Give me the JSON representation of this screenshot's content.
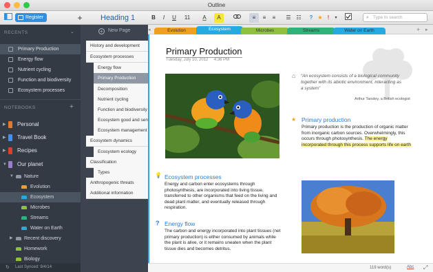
{
  "window": {
    "title": "Outline"
  },
  "toolbar": {
    "register_label": "Register",
    "add_label": "+",
    "heading_style": "Heading 1",
    "bold": "B",
    "italic": "I",
    "underline": "U",
    "font_size": "11",
    "search_placeholder": "Type to search"
  },
  "sidebar": {
    "recents_header": "RECENTS",
    "recents": [
      "Primary Production",
      "Energy flow",
      "Nutrient cycling",
      "Function and biodiversity",
      "Ecosystem processes"
    ],
    "notebooks_header": "NOTEBOOKS",
    "notebooks": [
      {
        "label": "Personal",
        "color": "#e07a2e"
      },
      {
        "label": "Travel Book",
        "color": "#4a8ee6"
      },
      {
        "label": "Recipes",
        "color": "#d9402f"
      },
      {
        "label": "Our planet",
        "color": "#9b7fc6"
      }
    ],
    "nature_label": "Nature",
    "sections": [
      {
        "label": "Evolution",
        "color": "#f0a020"
      },
      {
        "label": "Ecosystem",
        "color": "#27a9e1"
      },
      {
        "label": "Microbes",
        "color": "#8fc13e"
      },
      {
        "label": "Streams",
        "color": "#2fb37a"
      },
      {
        "label": "Water on Earth",
        "color": "#27a9e1"
      }
    ],
    "recent_discovery": "Recent discovery",
    "homework": "Homework",
    "biology": "Biology",
    "last_synced": "Last Synced: 9/4/14"
  },
  "pagelist": {
    "new_page": "New Page",
    "pages": [
      {
        "label": "History and development",
        "level": 0
      },
      {
        "label": "Ecosystem processes",
        "level": 0
      },
      {
        "label": "Energy flow",
        "level": 1
      },
      {
        "label": "Primary Production",
        "level": 1,
        "selected": true
      },
      {
        "label": "Decomposition",
        "level": 1
      },
      {
        "label": "Nutrient cycling",
        "level": 1
      },
      {
        "label": "Function and biodiversity",
        "level": 1
      },
      {
        "label": "Ecosystem good and services",
        "level": 1
      },
      {
        "label": "Ecosystem management",
        "level": 1
      },
      {
        "label": "Ecosystem dynamics",
        "level": 0
      },
      {
        "label": "Ecosystem ecology",
        "level": 1
      },
      {
        "label": "Classification",
        "level": 0
      },
      {
        "label": "Types",
        "level": 1
      },
      {
        "label": "Anthropogenic threats",
        "level": 0
      },
      {
        "label": "Additional information",
        "level": 0
      }
    ]
  },
  "tabs": [
    {
      "label": "Evolution",
      "color": "#f0a020"
    },
    {
      "label": "Ecosystem",
      "color": "#27a9e1"
    },
    {
      "label": "Microbes",
      "color": "#8fc13e"
    },
    {
      "label": "Streams",
      "color": "#2fb37a"
    },
    {
      "label": "Water on Earth",
      "color": "#27a9e1"
    }
  ],
  "note": {
    "title": "Primary Production",
    "date": "Tuesday, July 10, 2012",
    "time": "4:36 PM",
    "quote": "“An ecosystem consists of a biological community together with its abiotic environment, interacting as a system”",
    "quote_author": "Arthur Tansley, a British ecologist",
    "sec1_title": "Primary production",
    "sec1_text": "Primary production is the production of organic matter from inorganic carbon sources. Overwhelmingly, this occurs through photosynthesis.",
    "sec1_highlight": "The energy incorporated through this process supports life on earth",
    "sec2_title": "Ecosystem processes",
    "sec2_text": "Energy and carbon enter ecosystems through photosynthesis, are incorporated into living tissue, transferred to other organisms that feed on the living and dead plant matter, and eventually released through respiration.",
    "sec3_title": "Energy flow",
    "sec3_text": "The carbon and energy incorporated into plant tissues (net primary production) is either consumed by animals while the plant is alive, or it remains uneaten when the plant tissue dies and becomes detritus.",
    "word_count": "119 word(s)",
    "format_label": "Abc"
  }
}
